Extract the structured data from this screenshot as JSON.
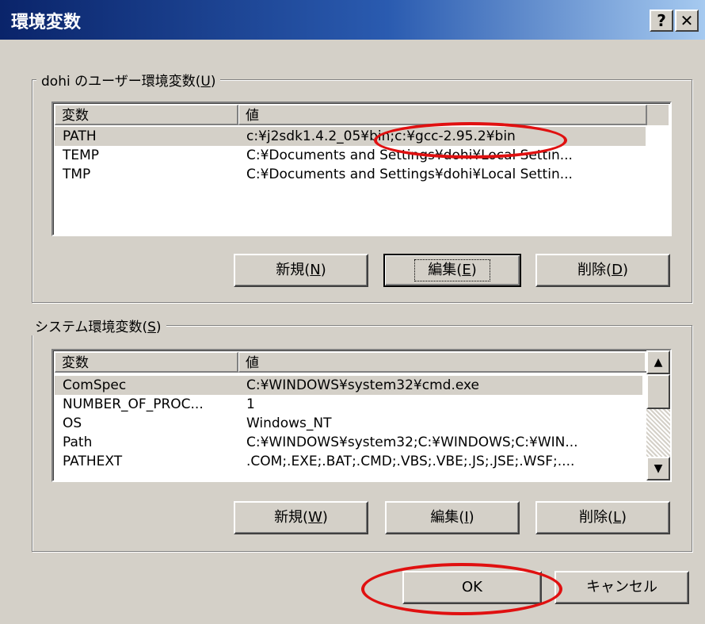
{
  "window": {
    "title": "環境変数",
    "help_glyph": "?",
    "close_glyph": "✕"
  },
  "user_group": {
    "label_pre": "dohi のユーザー環境変数(",
    "label_key": "U",
    "label_post": ")",
    "columns": [
      "変数",
      "値"
    ],
    "rows": [
      {
        "name": "PATH",
        "value": "c:¥j2sdk1.4.2_05¥bin;c:¥gcc-2.95.2¥bin",
        "selected": true
      },
      {
        "name": "TEMP",
        "value": "C:¥Documents and Settings¥dohi¥Local Settin...",
        "selected": false
      },
      {
        "name": "TMP",
        "value": "C:¥Documents and Settings¥dohi¥Local Settin...",
        "selected": false
      }
    ],
    "buttons": {
      "new": {
        "pre": "新規(",
        "key": "N",
        "post": ")"
      },
      "edit": {
        "pre": "編集(",
        "key": "E",
        "post": ")"
      },
      "delete": {
        "pre": "削除(",
        "key": "D",
        "post": ")"
      }
    }
  },
  "system_group": {
    "label_pre": "システム環境変数(",
    "label_key": "S",
    "label_post": ")",
    "columns": [
      "変数",
      "値"
    ],
    "rows": [
      {
        "name": "ComSpec",
        "value": "C:¥WINDOWS¥system32¥cmd.exe",
        "selected": true
      },
      {
        "name": "NUMBER_OF_PROC...",
        "value": "1",
        "selected": false
      },
      {
        "name": "OS",
        "value": "Windows_NT",
        "selected": false
      },
      {
        "name": "Path",
        "value": "C:¥WINDOWS¥system32;C:¥WINDOWS;C:¥WIN...",
        "selected": false
      },
      {
        "name": "PATHEXT",
        "value": ".COM;.EXE;.BAT;.CMD;.VBS;.VBE;.JS;.JSE;.WSF;....",
        "selected": false
      }
    ],
    "buttons": {
      "new": {
        "pre": "新規(",
        "key": "W",
        "post": ")"
      },
      "edit": {
        "pre": "編集(",
        "key": "I",
        "post": ")"
      },
      "delete": {
        "pre": "削除(",
        "key": "L",
        "post": ")"
      }
    },
    "scroll": {
      "up": "▲",
      "down": "▼"
    }
  },
  "footer": {
    "ok": "OK",
    "cancel": "キャンセル"
  },
  "colors": {
    "title_gradient_start": "#0a246a",
    "title_gradient_end": "#a6caf0",
    "dialog_face": "#d4d0c8",
    "annotation": "#e01010"
  }
}
